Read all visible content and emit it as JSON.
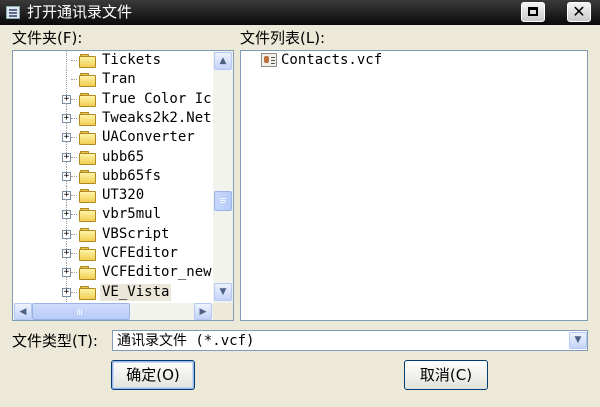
{
  "window": {
    "title": "打开通讯录文件",
    "maximize_glyph": "maximize-icon",
    "close_glyph": "✕"
  },
  "folders": {
    "label": "文件夹(F):",
    "items": [
      {
        "name": "Tickets",
        "expandable": false
      },
      {
        "name": "Tran",
        "expandable": false
      },
      {
        "name": "True Color Ic",
        "expandable": true
      },
      {
        "name": "Tweaks2k2.Net",
        "expandable": true
      },
      {
        "name": "UAConverter",
        "expandable": true
      },
      {
        "name": "ubb65",
        "expandable": true
      },
      {
        "name": "ubb65fs",
        "expandable": true
      },
      {
        "name": "UT320",
        "expandable": true
      },
      {
        "name": "vbr5mul",
        "expandable": true
      },
      {
        "name": "VBScript",
        "expandable": true
      },
      {
        "name": "VCFEditor",
        "expandable": true
      },
      {
        "name": "VCFEditor_new",
        "expandable": true
      },
      {
        "name": "VE_Vista",
        "expandable": true,
        "selected": true
      }
    ]
  },
  "files": {
    "label": "文件列表(L):",
    "items": [
      {
        "name": "Contacts.vcf",
        "icon": "vcf-file-icon"
      }
    ]
  },
  "filetype": {
    "label": "文件类型(T):",
    "value": "通讯录文件 (*.vcf)"
  },
  "buttons": {
    "ok": "确定(O)",
    "cancel": "取消(C)"
  },
  "colors": {
    "titlebar": "#0a0a0a",
    "dialog_bg": "#ece9d8",
    "panel_border": "#7f9db9",
    "button_border": "#003c74"
  }
}
